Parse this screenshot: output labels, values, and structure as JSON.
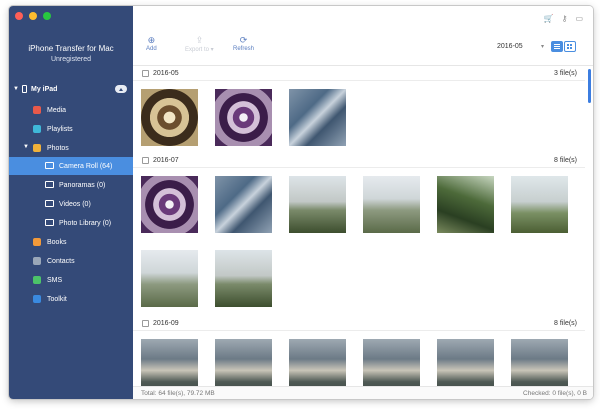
{
  "app": {
    "title": "iPhone Transfer for Mac",
    "subtitle": "Unregistered"
  },
  "colors": {
    "sidebar_bg": "#344a78",
    "selection": "#4a8ee0",
    "accent": "#5b7ec0"
  },
  "window_controls": [
    {
      "name": "close",
      "color": "#fe5f57"
    },
    {
      "name": "minimize",
      "color": "#febc2e"
    },
    {
      "name": "zoom",
      "color": "#28c840"
    }
  ],
  "device": {
    "label": "My iPad",
    "icon": "tablet-icon"
  },
  "sidebar": {
    "items": [
      {
        "label": "Media",
        "icon": "media-icon",
        "color": "#e8594a"
      },
      {
        "label": "Playlists",
        "icon": "playlist-icon",
        "color": "#3fb8d8"
      },
      {
        "label": "Photos",
        "icon": "photos-icon",
        "color": "#f0b13a"
      },
      {
        "label": "Camera Roll (64)",
        "icon": "folder-icon",
        "color": "#ffffff"
      },
      {
        "label": "Panoramas (0)",
        "icon": "folder-icon",
        "color": "#ffffff"
      },
      {
        "label": "Videos (0)",
        "icon": "folder-icon",
        "color": "#ffffff"
      },
      {
        "label": "Photo Library (0)",
        "icon": "folder-icon",
        "color": "#ffffff"
      },
      {
        "label": "Books",
        "icon": "books-icon",
        "color": "#f29a3a"
      },
      {
        "label": "Contacts",
        "icon": "contacts-icon",
        "color": "#9aa7b8"
      },
      {
        "label": "SMS",
        "icon": "sms-icon",
        "color": "#4cc469"
      },
      {
        "label": "Toolkit",
        "icon": "toolkit-icon",
        "color": "#3a8ae0"
      }
    ]
  },
  "toolbar": {
    "add_label": "Add",
    "export_label": "Export to",
    "refresh_label": "Refresh",
    "date_filter": "2016-05"
  },
  "header_icons": [
    "cart-icon",
    "key-icon",
    "chat-icon"
  ],
  "groups": [
    {
      "date": "2016-05",
      "count": "3 file(s)"
    },
    {
      "date": "2016-07",
      "count": "8 file(s)"
    },
    {
      "date": "2016-09",
      "count": "8 file(s)"
    }
  ],
  "status": {
    "left": "Total: 64 file(s), 79.72 MB",
    "right": "Checked: 0 file(s), 0 B"
  }
}
